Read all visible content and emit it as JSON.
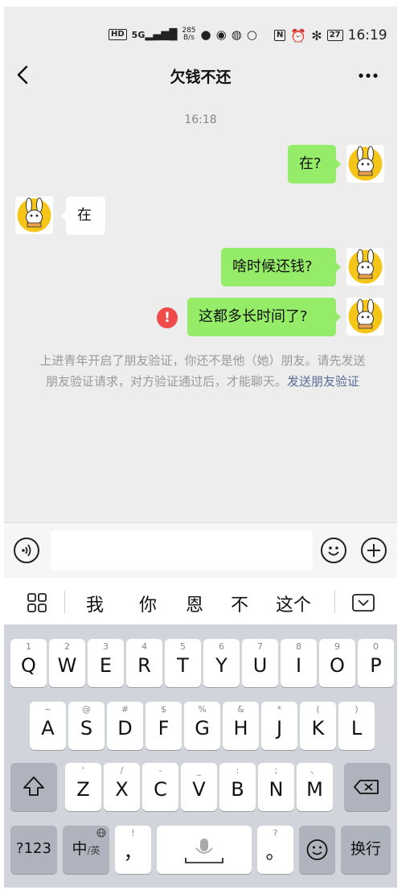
{
  "status_bar": {
    "hd": "HD",
    "network": "5G",
    "speed_value": "285",
    "speed_unit": "B/s",
    "nfc": "N",
    "battery": "27",
    "time": "16:19"
  },
  "nav": {
    "back_icon": "chevron-left-icon",
    "title": "欠钱不还",
    "more_icon": "more-dots-icon"
  },
  "chat": {
    "timestamp": "16:18",
    "messages": [
      {
        "from": "me",
        "text": "在?"
      },
      {
        "from": "other",
        "text": "在"
      },
      {
        "from": "me",
        "text": "啥时候还钱?"
      },
      {
        "from": "me",
        "text": "这都多长时间了?",
        "failed": true
      }
    ],
    "failed_icon": "!",
    "system_notice": "上进青年开启了朋友验证，你还不是他（她）朋友。请先发送朋友验证请求，对方验证通过后，才能聊天。",
    "system_link": "发送朋友验证"
  },
  "input_bar": {
    "voice_icon": "voice-icon",
    "emoji_icon": "emoji-icon",
    "plus_icon": "plus-icon",
    "placeholder": ""
  },
  "suggestions": {
    "grid_icon": "apps-grid-icon",
    "words": [
      "我",
      "你",
      "恩",
      "不",
      "这个"
    ],
    "collapse_icon": "keyboard-collapse-icon"
  },
  "keyboard": {
    "row1": [
      {
        "main": "Q",
        "hint": "1"
      },
      {
        "main": "W",
        "hint": "2"
      },
      {
        "main": "E",
        "hint": "3"
      },
      {
        "main": "R",
        "hint": "4"
      },
      {
        "main": "T",
        "hint": "5"
      },
      {
        "main": "Y",
        "hint": "6"
      },
      {
        "main": "U",
        "hint": "7"
      },
      {
        "main": "I",
        "hint": "8"
      },
      {
        "main": "O",
        "hint": "9"
      },
      {
        "main": "P",
        "hint": "0"
      }
    ],
    "row2": [
      {
        "main": "A",
        "hint": "~"
      },
      {
        "main": "S",
        "hint": "@"
      },
      {
        "main": "D",
        "hint": "#"
      },
      {
        "main": "F",
        "hint": "$"
      },
      {
        "main": "G",
        "hint": "%"
      },
      {
        "main": "H",
        "hint": "&"
      },
      {
        "main": "J",
        "hint": "*"
      },
      {
        "main": "K",
        "hint": "("
      },
      {
        "main": "L",
        "hint": ")"
      }
    ],
    "row3": [
      {
        "main": "Z",
        "hint": "'"
      },
      {
        "main": "X",
        "hint": "/"
      },
      {
        "main": "C",
        "hint": "-"
      },
      {
        "main": "V",
        "hint": "_"
      },
      {
        "main": "B",
        "hint": ":"
      },
      {
        "main": "N",
        "hint": ";"
      },
      {
        "main": "M",
        "hint": "、"
      }
    ],
    "shift_icon": "shift-icon",
    "delete_icon": "backspace-icon",
    "num_key": "?123",
    "lang_key_main": "中",
    "lang_key_sub": "/英",
    "lang_key_globe": "globe-icon",
    "comma_main": "，",
    "comma_hint": "!",
    "space_icon": "mic-icon",
    "period_main": "。",
    "period_hint": "?",
    "emoji_key_icon": "emoji-icon",
    "enter_label": "换行"
  }
}
